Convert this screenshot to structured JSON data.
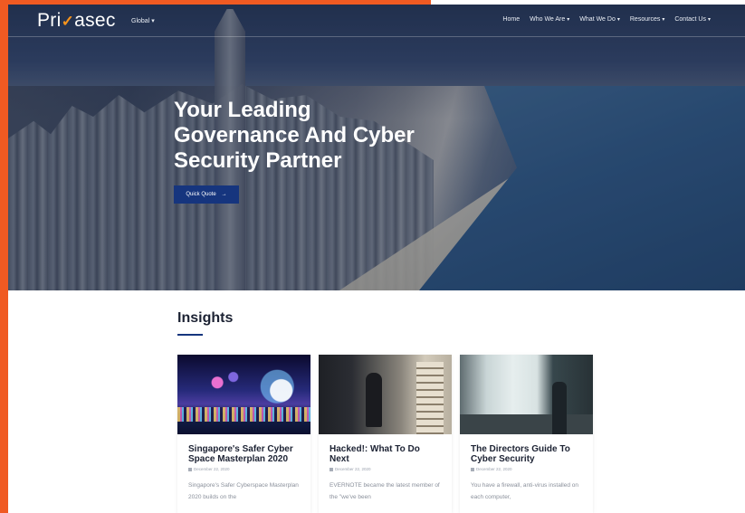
{
  "brand": {
    "logo_prefix": "Pri",
    "logo_mark": "✓",
    "logo_suffix": "asec",
    "accent": "#f05a22",
    "primary": "#16357e"
  },
  "nav": {
    "region": "Global",
    "items": [
      {
        "label": "Home",
        "dropdown": false
      },
      {
        "label": "Who We Are",
        "dropdown": true
      },
      {
        "label": "What We Do",
        "dropdown": true
      },
      {
        "label": "Resources",
        "dropdown": true
      },
      {
        "label": "Contact Us",
        "dropdown": true
      }
    ]
  },
  "hero": {
    "title_line1": "Your Leading",
    "title_line2": "Governance And Cyber",
    "title_line3": "Security Partner",
    "cta_label": "Quick Quote",
    "cta_arrow": "→"
  },
  "insights": {
    "heading": "Insights",
    "cards": [
      {
        "title": "Singapore's Safer Cyber Space Masterplan 2020",
        "date": "December 22, 2020",
        "excerpt": "Singapore's Safer Cyberspace Masterplan 2020 builds on the",
        "image": "singapore-skyline-image"
      },
      {
        "title": "Hacked!: What To Do Next",
        "date": "December 22, 2020",
        "excerpt": "EVERNOTE became the latest member of the \"we've been",
        "image": "burglar-image"
      },
      {
        "title": "The Directors Guide To Cyber Security",
        "date": "December 22, 2020",
        "excerpt": "You have a firewall, anti-virus installed on each computer,",
        "image": "director-office-image"
      }
    ]
  }
}
